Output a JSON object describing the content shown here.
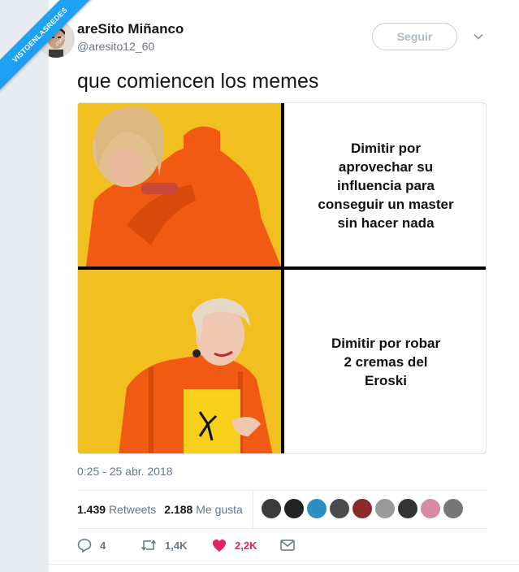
{
  "watermark": {
    "text": "VISTOENLASREDES",
    "sub": ".com"
  },
  "author": {
    "display_name": "areSito Miñanco",
    "handle": "@aresito12_60"
  },
  "follow_button": "Seguir",
  "tweet": {
    "text": "que comiencen los memes"
  },
  "meme": {
    "top_caption": "Dimitir por\naprovechar su\ninfluencia para\nconseguir un master\nsin hacer nada",
    "bottom_caption": "Dimitir por robar\n2 cremas del\nEroski"
  },
  "timestamp": "0:25 - 25 abr. 2018",
  "stats": {
    "retweets_count": "1.439",
    "retweets_label": "Retweets",
    "likes_count": "2.188",
    "likes_label": "Me gusta"
  },
  "actions": {
    "replies": "4",
    "retweets": "1,4K",
    "likes": "2,2K"
  },
  "colors": {
    "accent": "#1da1f2",
    "like": "#e0245e",
    "meme_bg": "#f2c01e",
    "jacket": "#f15a12"
  },
  "icons": [
    "reply-icon",
    "retweet-icon",
    "heart-icon",
    "mail-icon",
    "chevron-down-icon"
  ]
}
